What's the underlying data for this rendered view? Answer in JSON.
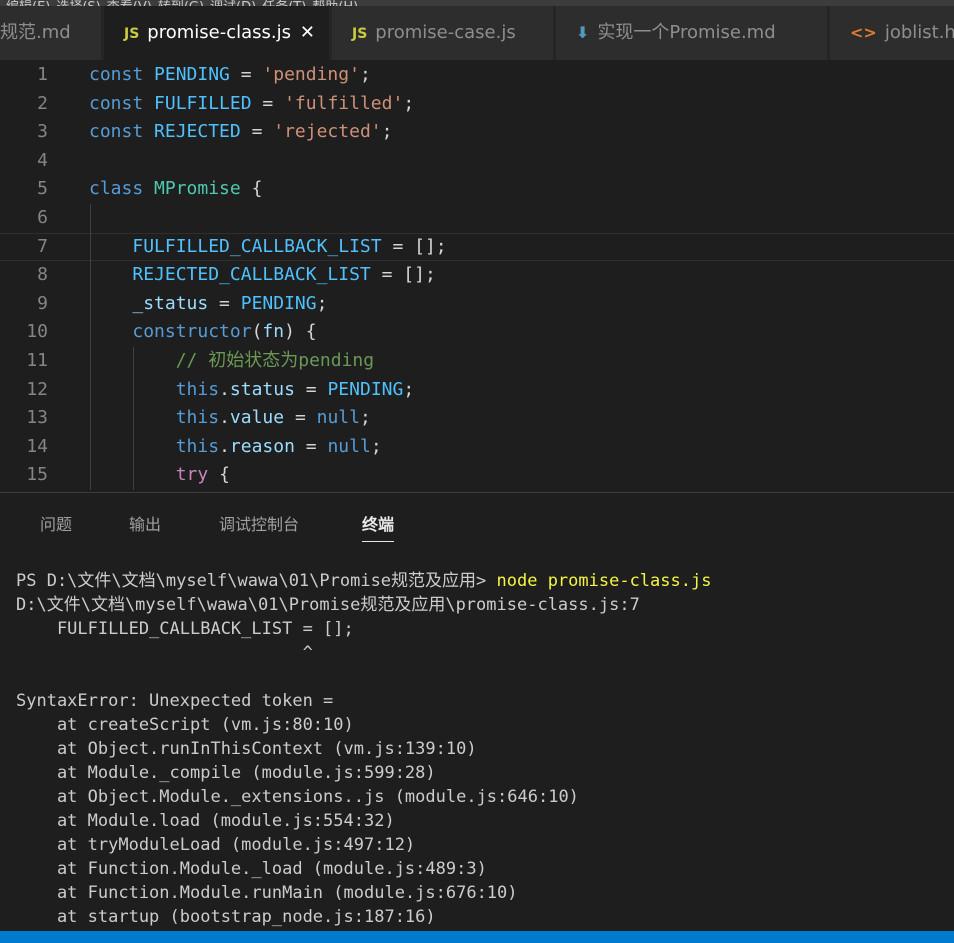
{
  "menu_strip": [
    "编辑(E)",
    "选择(S)",
    "查看(V)",
    "转到(G)",
    "调试(D)",
    "任务(T)",
    "帮助(H)"
  ],
  "tabs": [
    {
      "label": "规范.md",
      "icon": "markdown-icon",
      "active": false
    },
    {
      "label": "promise-class.js",
      "icon": "js-icon",
      "icon_text": "JS",
      "active": true,
      "close": "✕"
    },
    {
      "label": "promise-case.js",
      "icon": "js-icon",
      "icon_text": "JS",
      "active": false
    },
    {
      "label": "实现一个Promise.md",
      "icon": "markdown-icon",
      "icon_text": "⬇",
      "active": false
    },
    {
      "label": "joblist.html",
      "icon": "html-icon",
      "icon_text": "<>",
      "active": false
    }
  ],
  "editor": {
    "current_line": 7,
    "lines": [
      {
        "n": "1",
        "indent": 0,
        "tokens": [
          [
            "k",
            "const"
          ],
          [
            "t",
            " "
          ],
          [
            "c",
            "PENDING"
          ],
          [
            "t",
            " = "
          ],
          [
            "s",
            "'pending'"
          ],
          [
            "t",
            ";"
          ]
        ]
      },
      {
        "n": "2",
        "indent": 0,
        "tokens": [
          [
            "k",
            "const"
          ],
          [
            "t",
            " "
          ],
          [
            "c",
            "FULFILLED"
          ],
          [
            "t",
            " = "
          ],
          [
            "s",
            "'fulfilled'"
          ],
          [
            "t",
            ";"
          ]
        ]
      },
      {
        "n": "3",
        "indent": 0,
        "tokens": [
          [
            "k",
            "const"
          ],
          [
            "t",
            " "
          ],
          [
            "c",
            "REJECTED"
          ],
          [
            "t",
            " = "
          ],
          [
            "s",
            "'rejected'"
          ],
          [
            "t",
            ";"
          ]
        ]
      },
      {
        "n": "4",
        "indent": 0,
        "tokens": []
      },
      {
        "n": "5",
        "indent": 0,
        "tokens": [
          [
            "k",
            "class"
          ],
          [
            "t",
            " "
          ],
          [
            "cl",
            "MPromise"
          ],
          [
            "t",
            " {"
          ]
        ]
      },
      {
        "n": "6",
        "indent": 1,
        "tokens": []
      },
      {
        "n": "7",
        "indent": 1,
        "tokens": [
          [
            "c",
            "FULFILLED_CALLBACK_LIST"
          ],
          [
            "t",
            " = [];"
          ]
        ]
      },
      {
        "n": "8",
        "indent": 1,
        "tokens": [
          [
            "c",
            "REJECTED_CALLBACK_LIST"
          ],
          [
            "t",
            " = [];"
          ]
        ]
      },
      {
        "n": "9",
        "indent": 1,
        "tokens": [
          [
            "v",
            "_status"
          ],
          [
            "t",
            " = "
          ],
          [
            "c",
            "PENDING"
          ],
          [
            "t",
            ";"
          ]
        ]
      },
      {
        "n": "10",
        "indent": 1,
        "tokens": [
          [
            "k",
            "constructor"
          ],
          [
            "t",
            "("
          ],
          [
            "v",
            "fn"
          ],
          [
            "t",
            ") {"
          ]
        ]
      },
      {
        "n": "11",
        "indent": 2,
        "tokens": [
          [
            "cm",
            "// 初始状态为pending"
          ]
        ]
      },
      {
        "n": "12",
        "indent": 2,
        "tokens": [
          [
            "k",
            "this"
          ],
          [
            "t",
            "."
          ],
          [
            "v",
            "status"
          ],
          [
            "t",
            " = "
          ],
          [
            "c",
            "PENDING"
          ],
          [
            "t",
            ";"
          ]
        ]
      },
      {
        "n": "13",
        "indent": 2,
        "tokens": [
          [
            "k",
            "this"
          ],
          [
            "t",
            "."
          ],
          [
            "v",
            "value"
          ],
          [
            "t",
            " = "
          ],
          [
            "k",
            "null"
          ],
          [
            "t",
            ";"
          ]
        ]
      },
      {
        "n": "14",
        "indent": 2,
        "tokens": [
          [
            "k",
            "this"
          ],
          [
            "t",
            "."
          ],
          [
            "v",
            "reason"
          ],
          [
            "t",
            " = "
          ],
          [
            "k",
            "null"
          ],
          [
            "t",
            ";"
          ]
        ]
      },
      {
        "n": "15",
        "indent": 2,
        "tokens": [
          [
            "ck",
            "try"
          ],
          [
            "t",
            " {"
          ]
        ]
      }
    ]
  },
  "panel": {
    "tabs": [
      {
        "label": "问题",
        "active": false
      },
      {
        "label": "输出",
        "active": false
      },
      {
        "label": "调试控制台",
        "active": false
      },
      {
        "label": "终端",
        "active": true
      }
    ]
  },
  "terminal": {
    "prompt": "PS D:\\文件\\文档\\myself\\wawa\\01\\Promise规范及应用> ",
    "command": "node promise-class.js",
    "output": [
      "D:\\文件\\文档\\myself\\wawa\\01\\Promise规范及应用\\promise-class.js:7",
      "    FULFILLED_CALLBACK_LIST = [];",
      "                            ^",
      "",
      "SyntaxError: Unexpected token =",
      "    at createScript (vm.js:80:10)",
      "    at Object.runInThisContext (vm.js:139:10)",
      "    at Module._compile (module.js:599:28)",
      "    at Object.Module._extensions..js (module.js:646:10)",
      "    at Module.load (module.js:554:32)",
      "    at tryModuleLoad (module.js:497:12)",
      "    at Function.Module._load (module.js:489:3)",
      "    at Function.Module.runMain (module.js:676:10)",
      "    at startup (bootstrap_node.js:187:16)"
    ]
  },
  "colors": {
    "editor_bg": "#1e1e1e",
    "tab_bar_bg": "#252526",
    "status_bar_bg": "#007acc",
    "keyword": "#569cd6",
    "string": "#ce9178",
    "constant": "#4fc1ff",
    "comment": "#6a9955"
  }
}
